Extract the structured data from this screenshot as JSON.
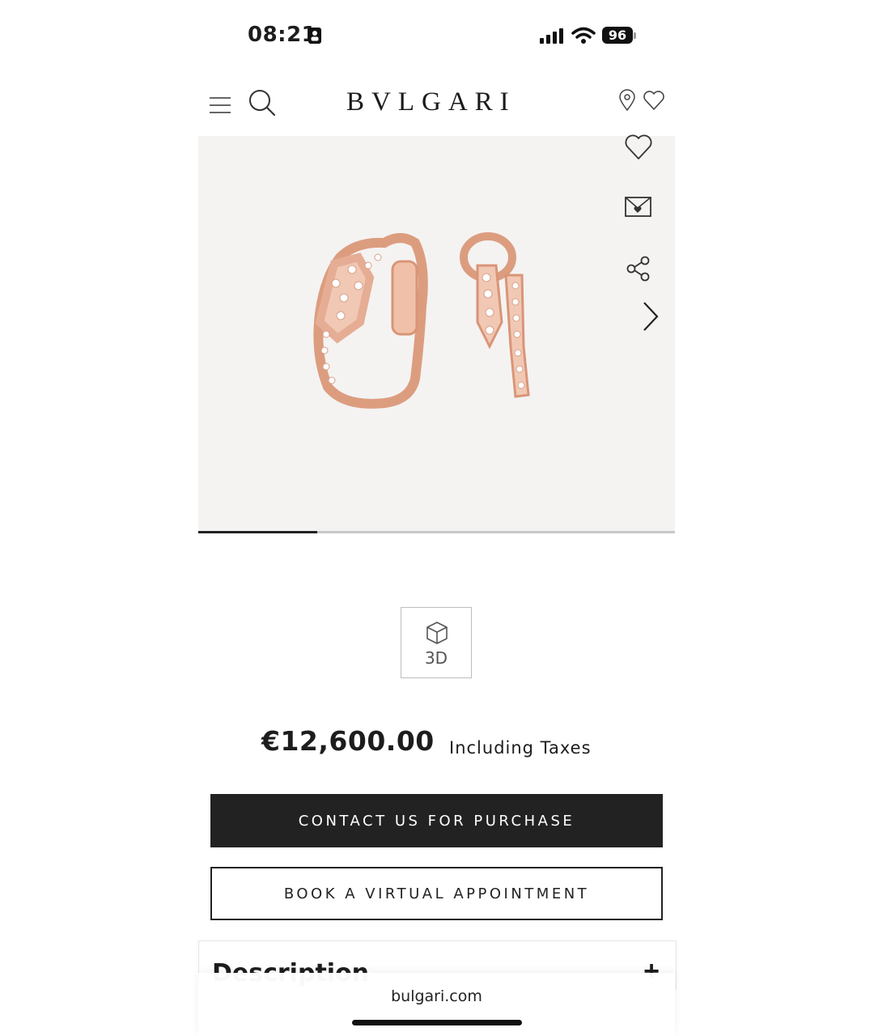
{
  "status_bar": {
    "time": "08:21",
    "battery": "96",
    "icons": [
      "person-badge-icon",
      "signal-icon",
      "wifi-icon",
      "battery-icon"
    ]
  },
  "header": {
    "brand": "BVLGARI",
    "icons": [
      "menu-icon",
      "search-icon",
      "location-pin-icon",
      "wishlist-heart-icon"
    ]
  },
  "gallery": {
    "actions": [
      "favorite-heart-icon",
      "email-icon",
      "share-icon",
      "chevron-right-icon"
    ],
    "current_slide": 1,
    "progress_fraction": 0.25,
    "colors": {
      "background": "#f4f3f2",
      "rose_gold": "#e2a384"
    }
  },
  "viewer": {
    "label": "3D"
  },
  "pricing": {
    "price": "€12,600.00",
    "tax_note": "Including Taxes"
  },
  "actions": {
    "contact_label": "CONTACT US FOR PURCHASE",
    "appointment_label": "BOOK A VIRTUAL APPOINTMENT"
  },
  "accordion": {
    "description_label": "Description",
    "toggle": "+"
  },
  "browser": {
    "url": "bulgari.com"
  },
  "colors": {
    "primary_button": "#222222",
    "text": "#1d1d1d"
  }
}
